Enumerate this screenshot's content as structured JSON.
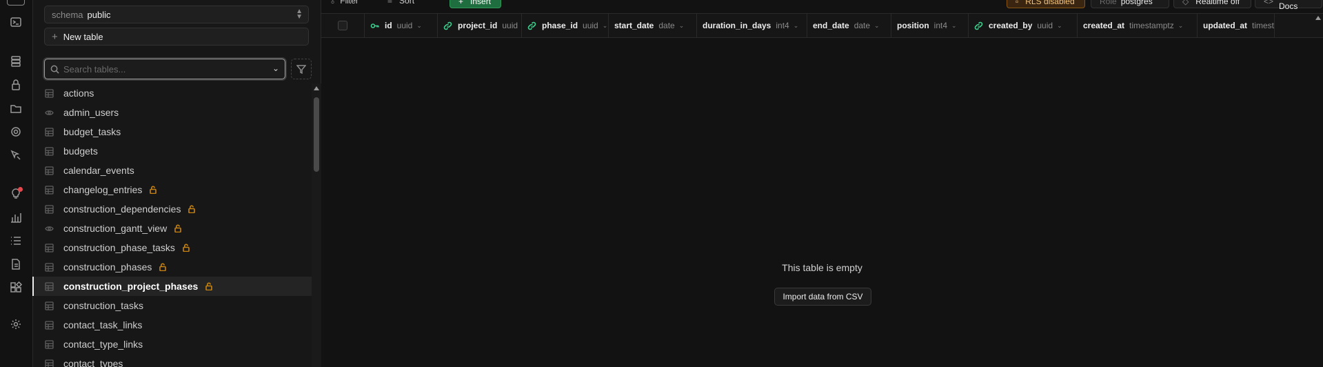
{
  "rail": {
    "icons": [
      "table-editor-icon",
      "sql-editor-icon",
      "database-icon",
      "auth-icon",
      "storage-icon",
      "edge-functions-icon",
      "realtime-icon",
      "advisors-icon",
      "reports-icon",
      "logs-icon",
      "api-docs-icon",
      "integrations-icon",
      "settings-icon"
    ]
  },
  "sidebar": {
    "schema_label": "schema",
    "schema_value": "public",
    "new_table_label": "New table",
    "search_placeholder": "Search tables...",
    "tables": [
      {
        "name": "actions",
        "kind": "table",
        "locked": false
      },
      {
        "name": "admin_users",
        "kind": "view",
        "locked": false
      },
      {
        "name": "budget_tasks",
        "kind": "table",
        "locked": false
      },
      {
        "name": "budgets",
        "kind": "table",
        "locked": false
      },
      {
        "name": "calendar_events",
        "kind": "table",
        "locked": false
      },
      {
        "name": "changelog_entries",
        "kind": "table",
        "locked": true
      },
      {
        "name": "construction_dependencies",
        "kind": "table",
        "locked": true
      },
      {
        "name": "construction_gantt_view",
        "kind": "view",
        "locked": true
      },
      {
        "name": "construction_phase_tasks",
        "kind": "table",
        "locked": true
      },
      {
        "name": "construction_phases",
        "kind": "table",
        "locked": true
      },
      {
        "name": "construction_project_phases",
        "kind": "table",
        "locked": true,
        "active": true
      },
      {
        "name": "construction_tasks",
        "kind": "table",
        "locked": false
      },
      {
        "name": "contact_task_links",
        "kind": "table",
        "locked": false
      },
      {
        "name": "contact_type_links",
        "kind": "table",
        "locked": false
      },
      {
        "name": "contact_types",
        "kind": "table",
        "locked": false
      }
    ]
  },
  "toolbar": {
    "filter_label": "Filter",
    "sort_label": "Sort",
    "insert_label": "Insert",
    "rls_label": "RLS disabled",
    "role_prefix": "Role",
    "role_value": "postgres",
    "realtime_label": "Realtime off",
    "api_docs_label": "API Docs"
  },
  "columns": [
    {
      "name": "id",
      "type": "uuid",
      "icon": "key-icon"
    },
    {
      "name": "project_id",
      "type": "uuid",
      "icon": "link-icon"
    },
    {
      "name": "phase_id",
      "type": "uuid",
      "icon": "link-icon"
    },
    {
      "name": "start_date",
      "type": "date",
      "icon": ""
    },
    {
      "name": "duration_in_days",
      "type": "int4",
      "icon": ""
    },
    {
      "name": "end_date",
      "type": "date",
      "icon": ""
    },
    {
      "name": "position",
      "type": "int4",
      "icon": ""
    },
    {
      "name": "created_by",
      "type": "uuid",
      "icon": "link-icon"
    },
    {
      "name": "created_at",
      "type": "timestamptz",
      "icon": ""
    },
    {
      "name": "updated_at",
      "type": "timestamptz",
      "icon": ""
    }
  ],
  "empty_state": {
    "message": "This table is empty",
    "import_label": "Import data from CSV"
  },
  "colors": {
    "accent_green": "#3ecf8e",
    "lock_orange": "#c8830f",
    "rls_warning": "#8a5512"
  }
}
